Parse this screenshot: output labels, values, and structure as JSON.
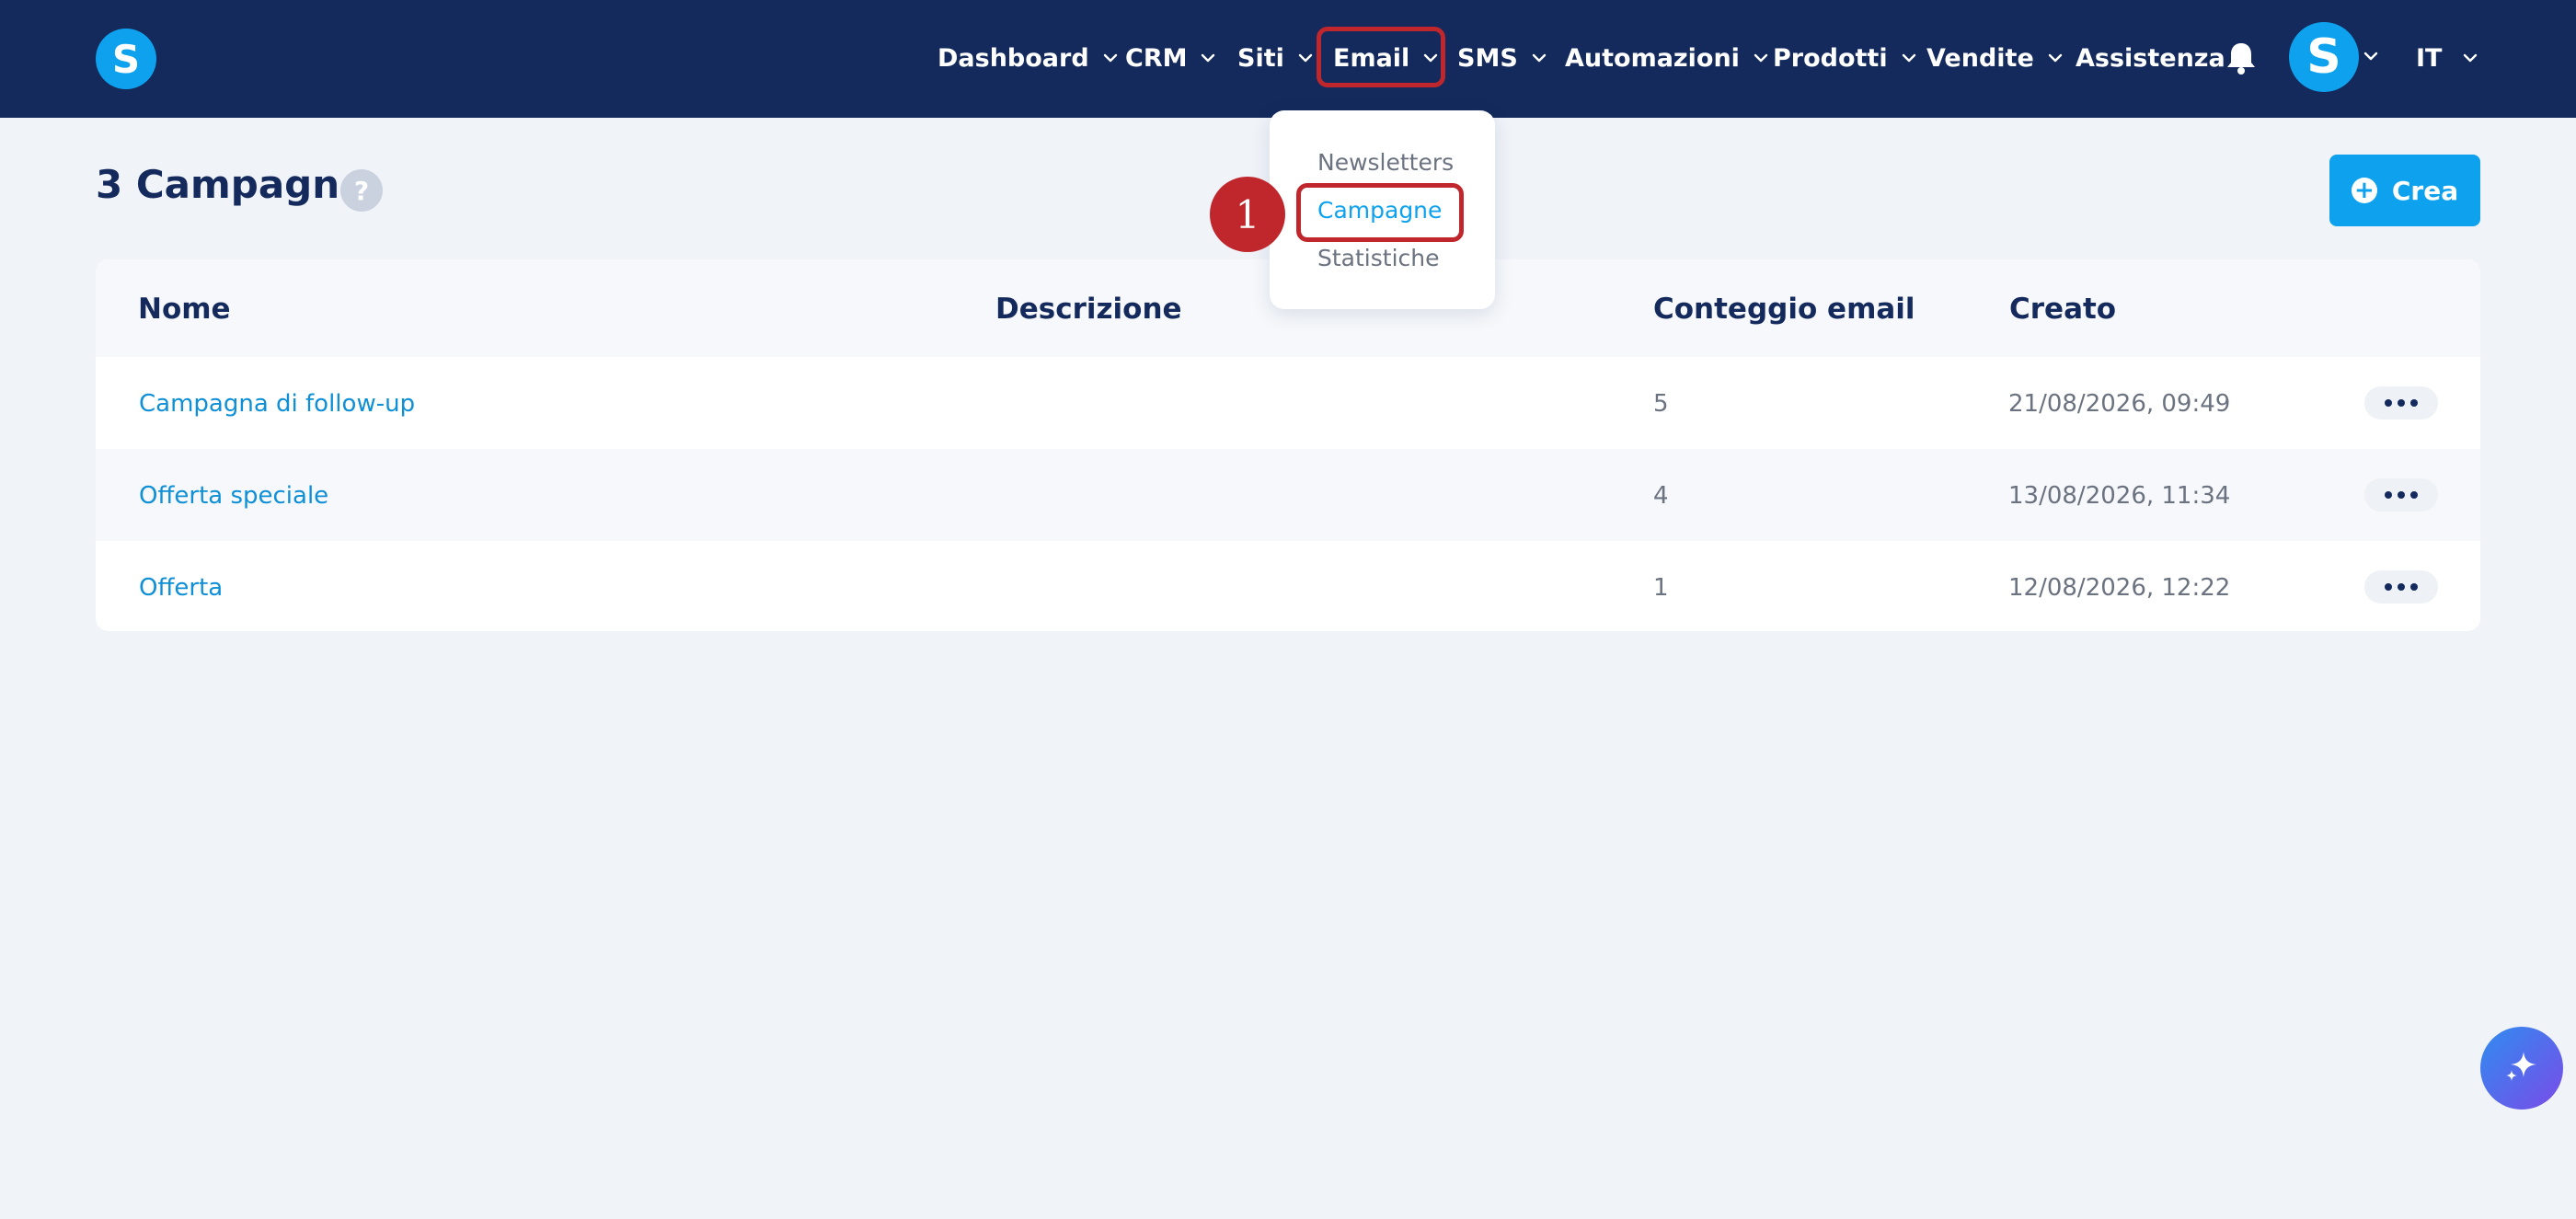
{
  "app": {
    "logo_letter": "S"
  },
  "nav": {
    "items": [
      {
        "label": "Dashboard"
      },
      {
        "label": "CRM"
      },
      {
        "label": "Siti"
      },
      {
        "label": "Email"
      },
      {
        "label": "SMS"
      },
      {
        "label": "Automazioni"
      },
      {
        "label": "Prodotti"
      },
      {
        "label": "Vendite"
      },
      {
        "label": "Assistenza"
      }
    ],
    "avatar_letter": "S",
    "language": "IT",
    "active_item": "Email"
  },
  "dropdown": {
    "items": [
      {
        "label": "Newsletters"
      },
      {
        "label": "Campagne"
      },
      {
        "label": "Statistiche"
      }
    ],
    "selected": "Campagne",
    "step_marker": "1"
  },
  "page": {
    "title": "3 Campagne",
    "help_symbol": "?",
    "create_label": "Crea"
  },
  "table": {
    "columns": [
      "Nome",
      "Descrizione",
      "Conteggio email",
      "Creato"
    ],
    "rows": [
      {
        "name": "Campagna di follow-up",
        "description": "",
        "email_count": "5",
        "created": "21/08/2026, 09:49"
      },
      {
        "name": "Offerta speciale",
        "description": "",
        "email_count": "4",
        "created": "13/08/2026, 11:34"
      },
      {
        "name": "Offerta",
        "description": "",
        "email_count": "1",
        "created": "12/08/2026, 12:22"
      }
    ]
  },
  "icons": {
    "bell": "bell-icon",
    "chevron": "chevron-down-icon",
    "help": "question-icon",
    "plus": "plus-circle-icon",
    "more": "more-dots-icon",
    "ai": "sparkle-icon"
  },
  "colors": {
    "navbar": "#142a5c",
    "accent": "#0ea2ee",
    "highlight": "#c0272d",
    "background": "#f0f3f8"
  }
}
